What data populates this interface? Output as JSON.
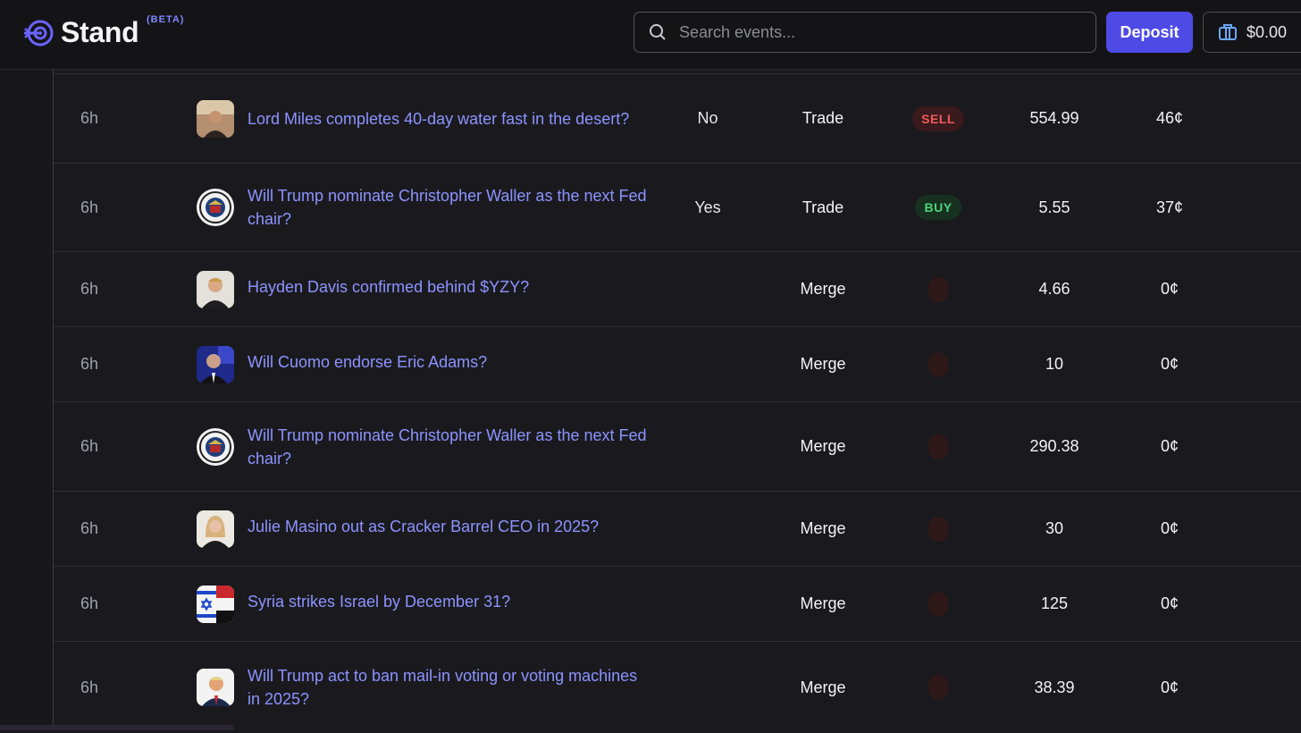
{
  "header": {
    "brand": "Stand",
    "beta": "(BETA)",
    "search_placeholder": "Search events...",
    "deposit_label": "Deposit",
    "balance": "$0.00"
  },
  "colors": {
    "accent": "#4e4ae6",
    "link": "#8d93ff",
    "sell": "#ef5b5b",
    "buy": "#4fd27a"
  },
  "rows": [
    {
      "time": "6h",
      "thumb": "lord-miles-photo",
      "title": "Lord Miles completes 40-day water fast in the desert?",
      "outcome": "No",
      "type": "Trade",
      "side": "SELL",
      "shares": "554.99",
      "price": "46¢"
    },
    {
      "time": "6h",
      "thumb": "fed-seal",
      "title": "Will Trump nominate Christopher Waller as the next Fed chair?",
      "outcome": "Yes",
      "type": "Trade",
      "side": "BUY",
      "shares": "5.55",
      "price": "37¢"
    },
    {
      "time": "6h",
      "thumb": "hayden-davis-photo",
      "title": "Hayden Davis confirmed behind $YZY?",
      "outcome": "",
      "type": "Merge",
      "side": "",
      "shares": "4.66",
      "price": "0¢"
    },
    {
      "time": "6h",
      "thumb": "cuomo-photo",
      "title": "Will Cuomo endorse Eric Adams?",
      "outcome": "",
      "type": "Merge",
      "side": "",
      "shares": "10",
      "price": "0¢"
    },
    {
      "time": "6h",
      "thumb": "fed-seal",
      "title": "Will Trump nominate Christopher Waller as the next Fed chair?",
      "outcome": "",
      "type": "Merge",
      "side": "",
      "shares": "290.38",
      "price": "0¢"
    },
    {
      "time": "6h",
      "thumb": "julie-masino-photo",
      "title": "Julie Masino out as Cracker Barrel CEO in 2025?",
      "outcome": "",
      "type": "Merge",
      "side": "",
      "shares": "30",
      "price": "0¢"
    },
    {
      "time": "6h",
      "thumb": "syria-israel-flags",
      "title": "Syria strikes Israel by December 31?",
      "outcome": "",
      "type": "Merge",
      "side": "",
      "shares": "125",
      "price": "0¢"
    },
    {
      "time": "6h",
      "thumb": "trump-photo",
      "title": "Will Trump act to ban mail-in voting or voting machines in 2025?",
      "outcome": "",
      "type": "Merge",
      "side": "",
      "shares": "38.39",
      "price": "0¢"
    }
  ]
}
